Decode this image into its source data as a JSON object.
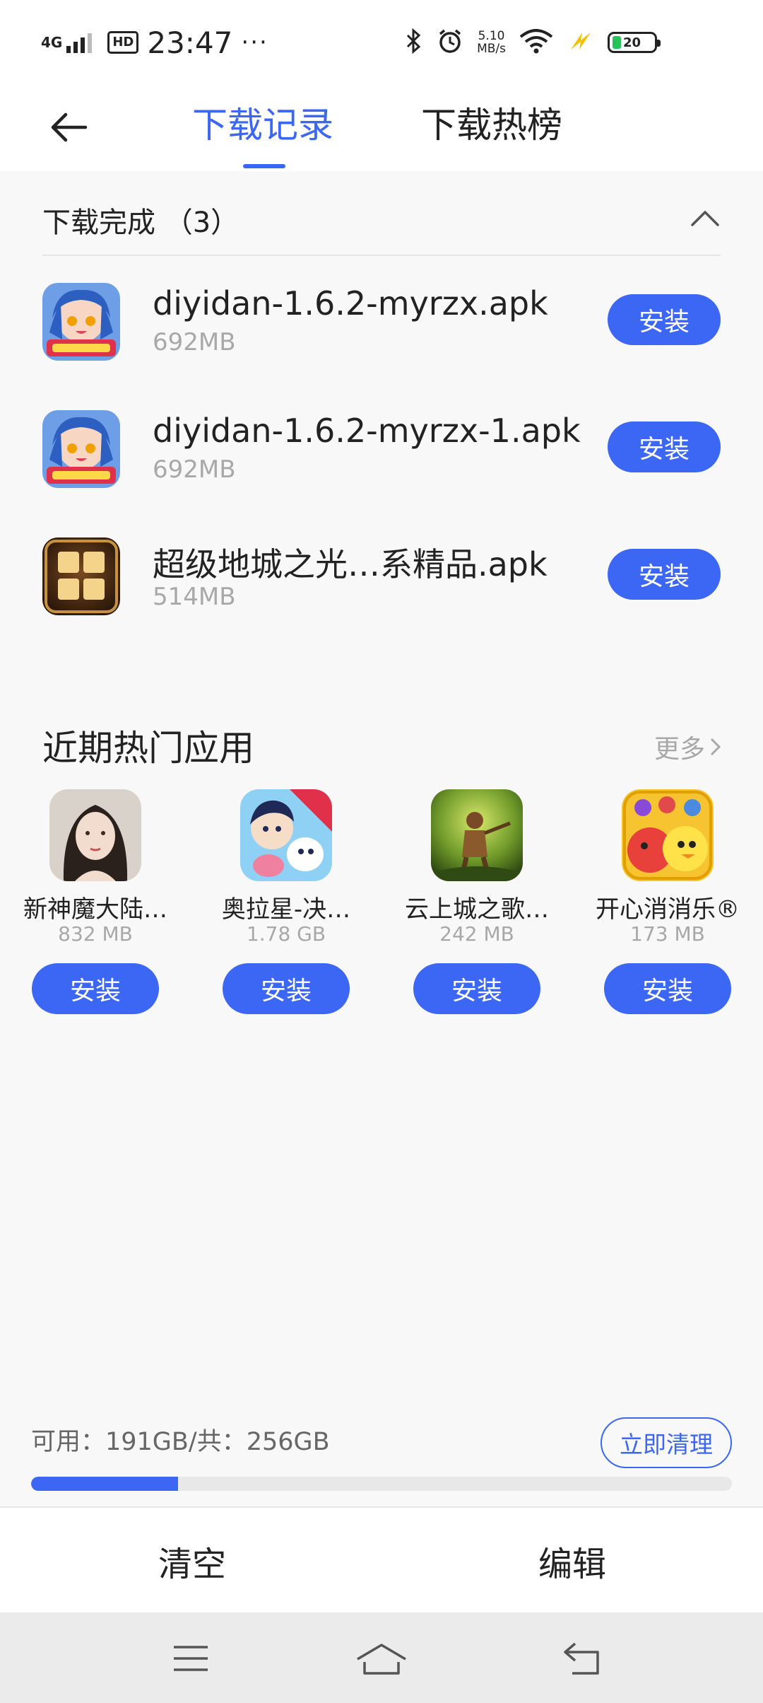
{
  "status_bar": {
    "network": "4G",
    "hd": "HD",
    "time": "23:47",
    "dots": "···",
    "speed_value": "5.10",
    "speed_unit": "MB/s",
    "battery": "20"
  },
  "nav": {
    "tabs": [
      {
        "label": "下载记录",
        "active": true
      },
      {
        "label": "下载热榜",
        "active": false
      }
    ]
  },
  "downloads": {
    "header": "下载完成 （3）",
    "items": [
      {
        "name": "diyidan-1.6.2-myrzx.apk",
        "size": "692MB",
        "button": "安装",
        "icon": "anime-girl-game-icon"
      },
      {
        "name": "diyidan-1.6.2-myrzx-1.apk",
        "size": "692MB",
        "button": "安装",
        "icon": "anime-girl-game-icon"
      },
      {
        "name": "超级地城之光…系精品.apk",
        "size": "514MB",
        "button": "安装",
        "icon": "dungeon-light-game-icon"
      }
    ]
  },
  "hot_apps": {
    "title": "近期热门应用",
    "more": "更多",
    "items": [
      {
        "name": "新神魔大陆…",
        "size": "832 MB",
        "button": "安装",
        "icon": "portrait-woman-icon"
      },
      {
        "name": "奥拉星-决…",
        "size": "1.78 GB",
        "button": "安装",
        "icon": "aola-star-icon"
      },
      {
        "name": "云上城之歌…",
        "size": "242 MB",
        "button": "安装",
        "icon": "forest-warrior-icon"
      },
      {
        "name": "开心消消乐®",
        "size": "173 MB",
        "button": "安装",
        "icon": "happy-birds-icon"
      }
    ]
  },
  "storage": {
    "text": "可用：191GB/共：256GB",
    "clean_button": "立即清理",
    "used_fraction": 0.21
  },
  "bottom_bar": {
    "clear": "清空",
    "edit": "编辑"
  },
  "colors": {
    "accent": "#3b67f4",
    "page_bg": "#f8f8f8",
    "subtle_text": "#a8a8a8"
  }
}
